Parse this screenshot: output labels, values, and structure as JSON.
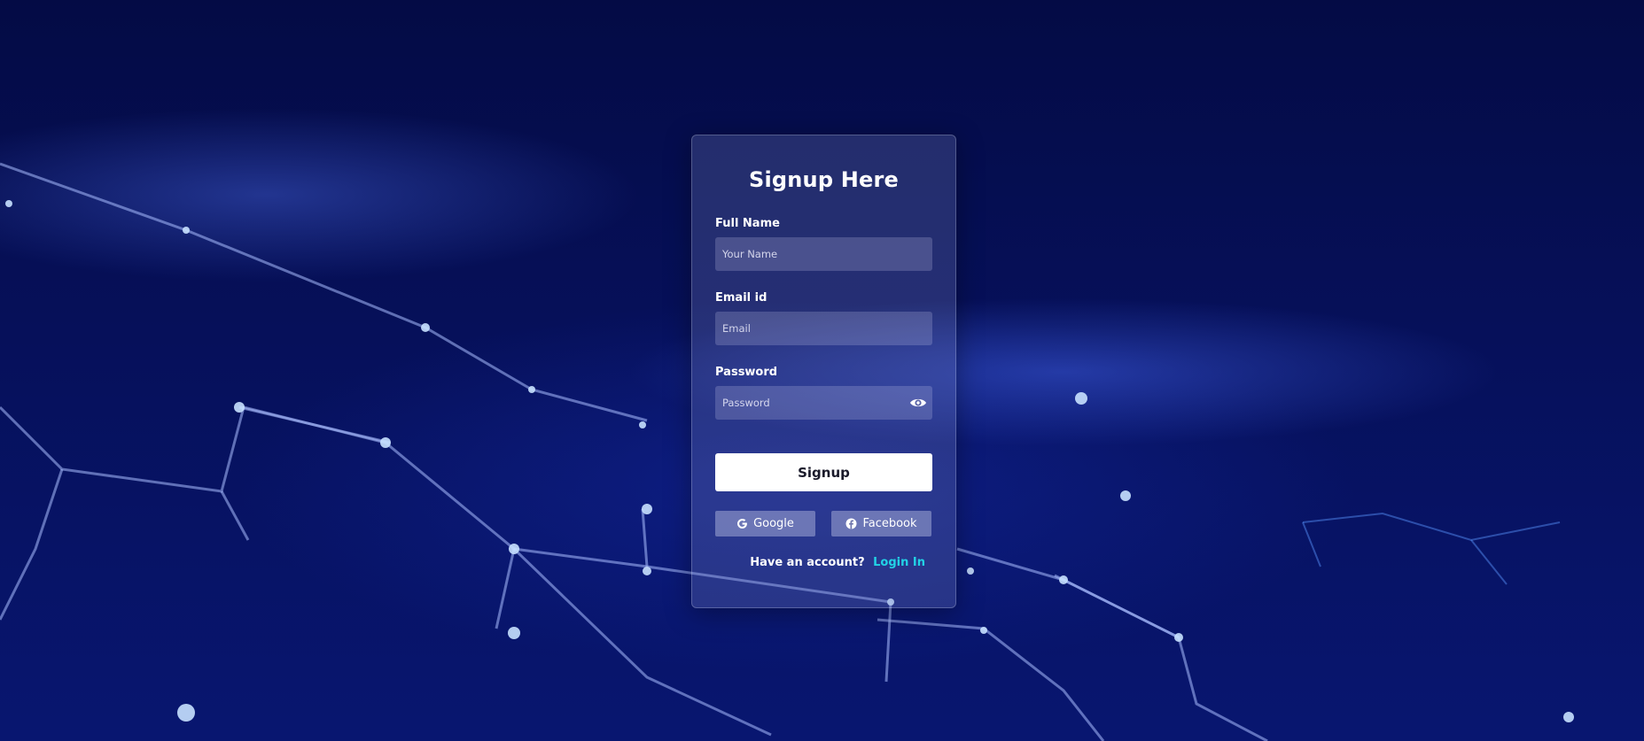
{
  "form": {
    "title": "Signup Here",
    "fields": [
      {
        "label": "Full Name",
        "placeholder": "Your Name",
        "value": ""
      },
      {
        "label": "Email id",
        "placeholder": "Email",
        "value": ""
      },
      {
        "label": "Password",
        "placeholder": "Password",
        "value": ""
      }
    ],
    "password_toggle_icon": "eye-icon",
    "submit_label": "Signup",
    "social": [
      {
        "label": "Google",
        "icon": "google-icon"
      },
      {
        "label": "Facebook",
        "icon": "facebook-icon"
      }
    ],
    "footer_text": "Have an account?",
    "footer_link": "Login In"
  },
  "colors": {
    "background": "#06105a",
    "link": "#22d3e6",
    "button": "#ffffff"
  }
}
